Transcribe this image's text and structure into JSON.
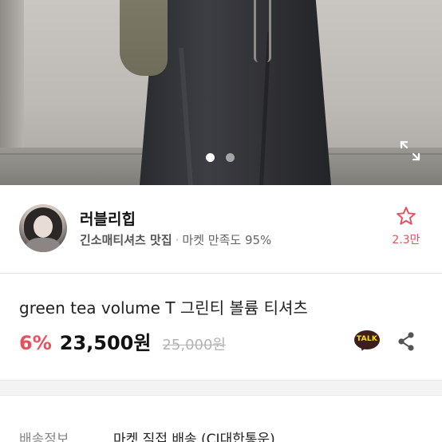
{
  "image": {
    "dots": [
      {
        "active": true
      },
      {
        "active": false
      }
    ]
  },
  "seller": {
    "name": "러블리힙",
    "description": "긴소매티셔츠 맛집",
    "separator": "·",
    "satisfaction": "마켓 만족도 95%",
    "favorite_count": "2.3만"
  },
  "product": {
    "title": "green tea volume T 그린티 볼륨 티셔츠",
    "discount": "6%",
    "price": "23,500원",
    "original_price": "25,000원"
  },
  "actions": {
    "kakao_label": "TALK"
  },
  "shipping": {
    "label": "배송정보",
    "value": "마켓 직접 배송 (CJ대한통운)"
  },
  "colors": {
    "accent": "#e8505b",
    "kakao_bubble": "#3c1e1e",
    "kakao_text": "#ffe100"
  },
  "icons": [
    "expand-icon",
    "star-icon",
    "kakao-talk-icon",
    "share-icon"
  ]
}
